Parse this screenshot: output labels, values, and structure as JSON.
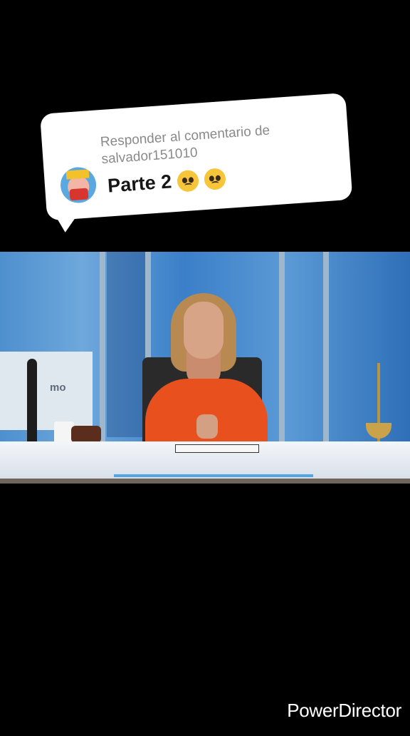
{
  "reply": {
    "label": "Responder al comentario de salvador151010",
    "title": "Parte 2",
    "emoji_icons": [
      "pleading-face-icon",
      "pleading-face-icon"
    ]
  },
  "video": {
    "backdrop_text": "mo"
  },
  "watermark": "PowerDirector",
  "colors": {
    "background": "#000000",
    "card": "#ffffff",
    "jacket": "#e8501e"
  }
}
